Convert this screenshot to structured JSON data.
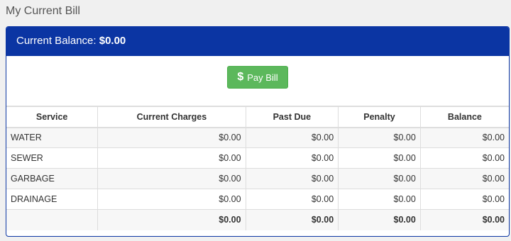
{
  "page": {
    "title": "My Current Bill"
  },
  "balance": {
    "label": "Current Balance:",
    "value": "$0.00"
  },
  "pay_button": {
    "icon": "dollar-icon",
    "label": "Pay Bill",
    "color": "#5cb85c"
  },
  "colors": {
    "header_bg": "#0b35a3",
    "page_bg": "#f0f0f0"
  },
  "table": {
    "columns": [
      "Service",
      "Current Charges",
      "Past Due",
      "Penalty",
      "Balance"
    ],
    "rows": [
      {
        "service": "WATER",
        "current": "$0.00",
        "past_due": "$0.00",
        "penalty": "$0.00",
        "balance": "$0.00"
      },
      {
        "service": "SEWER",
        "current": "$0.00",
        "past_due": "$0.00",
        "penalty": "$0.00",
        "balance": "$0.00"
      },
      {
        "service": "GARBAGE",
        "current": "$0.00",
        "past_due": "$0.00",
        "penalty": "$0.00",
        "balance": "$0.00"
      },
      {
        "service": "DRAINAGE",
        "current": "$0.00",
        "past_due": "$0.00",
        "penalty": "$0.00",
        "balance": "$0.00"
      }
    ],
    "totals": {
      "service": "",
      "current": "$0.00",
      "past_due": "$0.00",
      "penalty": "$0.00",
      "balance": "$0.00"
    }
  }
}
